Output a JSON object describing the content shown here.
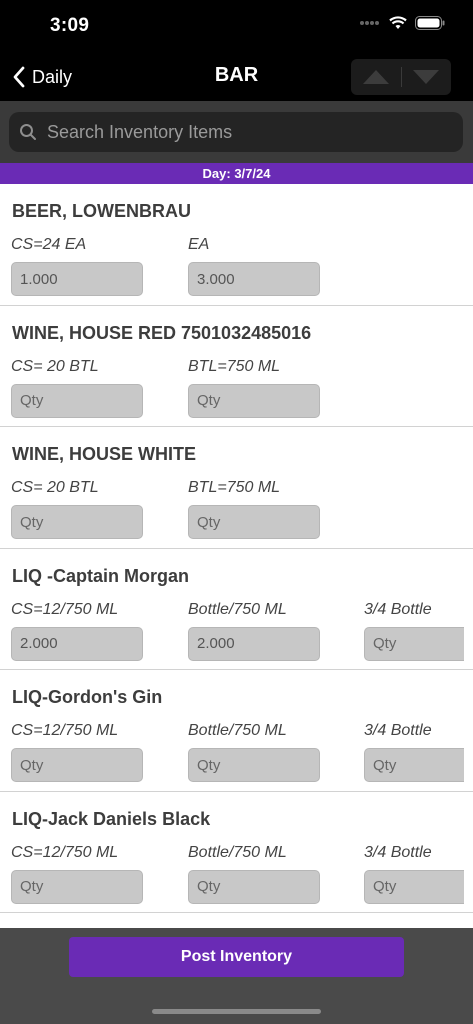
{
  "status": {
    "time": "3:09"
  },
  "nav": {
    "back_label": "Daily",
    "title": "BAR"
  },
  "search": {
    "placeholder": "Search Inventory Items"
  },
  "day_banner": "Day: 3/7/24",
  "items": [
    {
      "name": "BEER, LOWENBRAU",
      "units": [
        {
          "label": "CS=24 EA",
          "value": "1.000",
          "placeholder": "Qty"
        },
        {
          "label": "EA",
          "value": "3.000",
          "placeholder": "Qty"
        }
      ]
    },
    {
      "name": "WINE, HOUSE RED 7501032485016",
      "units": [
        {
          "label": "CS= 20 BTL",
          "value": "",
          "placeholder": "Qty"
        },
        {
          "label": "BTL=750 ML",
          "value": "",
          "placeholder": "Qty"
        }
      ]
    },
    {
      "name": "WINE, HOUSE WHITE",
      "units": [
        {
          "label": "CS= 20 BTL",
          "value": "",
          "placeholder": "Qty"
        },
        {
          "label": "BTL=750 ML",
          "value": "",
          "placeholder": "Qty"
        }
      ]
    },
    {
      "name": "LIQ -Captain Morgan",
      "units": [
        {
          "label": "CS=12/750 ML",
          "value": "2.000",
          "placeholder": "Qty"
        },
        {
          "label": "Bottle/750 ML",
          "value": "2.000",
          "placeholder": "Qty"
        },
        {
          "label": "3/4 Bottle",
          "value": "",
          "placeholder": "Qty"
        }
      ]
    },
    {
      "name": "LIQ-Gordon's Gin",
      "units": [
        {
          "label": "CS=12/750 ML",
          "value": "",
          "placeholder": "Qty"
        },
        {
          "label": "Bottle/750 ML",
          "value": "",
          "placeholder": "Qty"
        },
        {
          "label": "3/4 Bottle",
          "value": "",
          "placeholder": "Qty"
        }
      ]
    },
    {
      "name": "LIQ-Jack Daniels Black",
      "units": [
        {
          "label": "CS=12/750 ML",
          "value": "",
          "placeholder": "Qty"
        },
        {
          "label": "Bottle/750 ML",
          "value": "",
          "placeholder": "Qty"
        },
        {
          "label": "3/4 Bottle",
          "value": "",
          "placeholder": "Qty"
        }
      ]
    }
  ],
  "footer": {
    "post_label": "Post Inventory"
  },
  "colors": {
    "accent": "#6a2bb5",
    "nav_bg": "#000000",
    "field_bg": "#c8c8c8"
  },
  "icons": {
    "back": "chevron-left-icon",
    "up": "arrow-up-icon",
    "down": "arrow-down-icon",
    "search": "magnifier-icon"
  }
}
